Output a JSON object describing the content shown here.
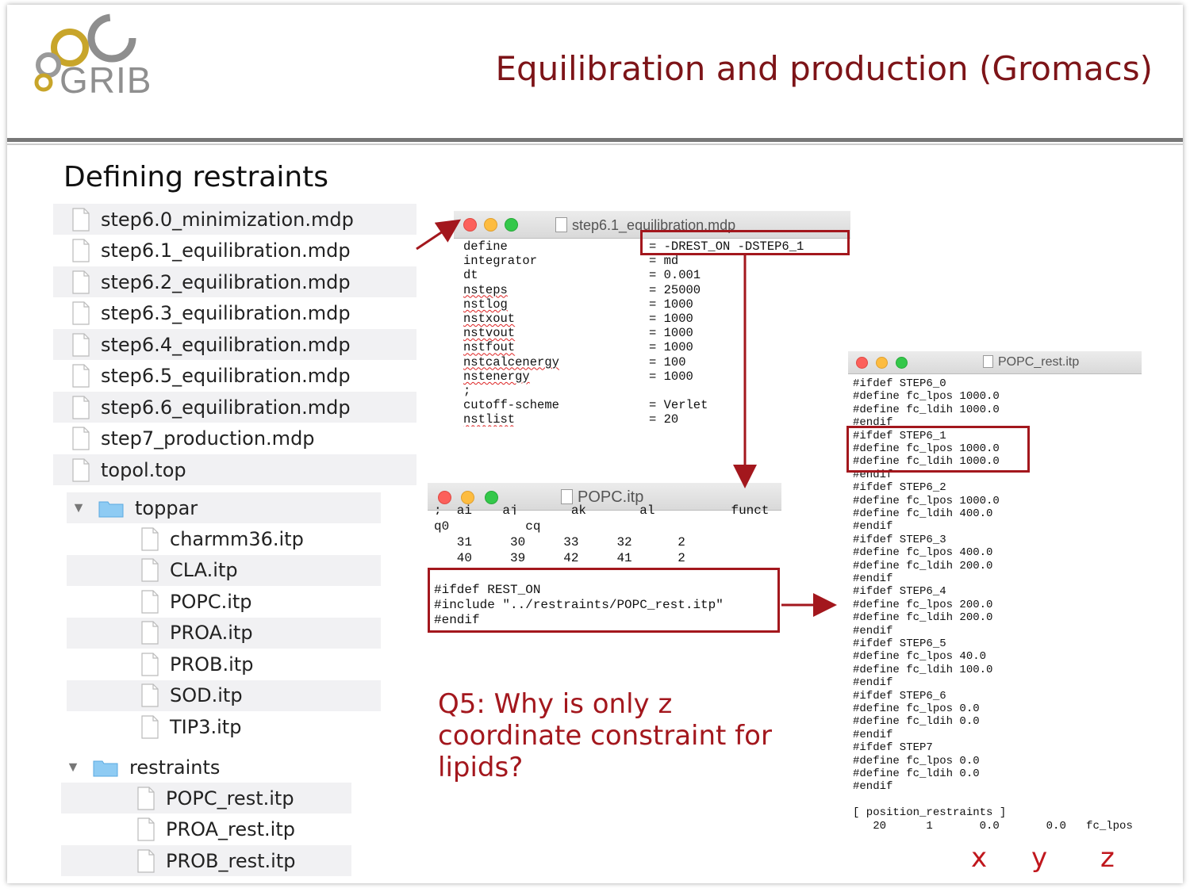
{
  "header": {
    "logo_text": "GRIB",
    "title": "Equilibration and production (Gromacs)"
  },
  "subtitle": "Defining restraints",
  "files": [
    "step6.0_minimization.mdp",
    "step6.1_equilibration.mdp",
    "step6.2_equilibration.mdp",
    "step6.3_equilibration.mdp",
    "step6.4_equilibration.mdp",
    "step6.5_equilibration.mdp",
    "step6.6_equilibration.mdp",
    "step7_production.mdp",
    "topol.top"
  ],
  "toppar": {
    "label": "toppar",
    "items": [
      "charmm36.itp",
      "CLA.itp",
      "POPC.itp",
      "PROA.itp",
      "PROB.itp",
      "SOD.itp",
      "TIP3.itp"
    ]
  },
  "restraints": {
    "label": "restraints",
    "items": [
      "POPC_rest.itp",
      "PROA_rest.itp",
      "PROB_rest.itp"
    ]
  },
  "mdp_window": {
    "title": "step6.1_equilibration.mdp",
    "lines": [
      [
        "define",
        "= -DREST_ON -DSTEP6_1"
      ],
      [
        "integrator",
        "= md"
      ],
      [
        "dt",
        "= 0.001"
      ],
      [
        "nsteps",
        "= 25000"
      ],
      [
        "nstlog",
        "= 1000"
      ],
      [
        "nstxout",
        "= 1000"
      ],
      [
        "nstvout",
        "= 1000"
      ],
      [
        "nstfout",
        "= 1000"
      ],
      [
        "nstcalcenergy",
        "= 100"
      ],
      [
        "nstenergy",
        "= 1000"
      ],
      [
        ";",
        ""
      ],
      [
        "cutoff-scheme",
        "= Verlet"
      ],
      [
        "nstlist",
        "= 20"
      ]
    ]
  },
  "popc_window": {
    "title": "POPC.itp",
    "cut_header": ";  ai    aj       ak       al          funct",
    "header2": "q0          cq",
    "rows": [
      "   31     30     33     32      2",
      "   40     39     42     41      2"
    ],
    "ifdef_block": [
      "#ifdef REST_ON",
      "#include \"../restraints/POPC_rest.itp\"",
      "#endif"
    ]
  },
  "rest_window": {
    "title": "POPC_rest.itp",
    "lines": [
      "#ifdef STEP6_0",
      "#define fc_lpos 1000.0",
      "#define fc_ldih 1000.0",
      "#endif",
      "#ifdef STEP6_1",
      "#define fc_lpos 1000.0",
      "#define fc_ldih 1000.0",
      "#endif",
      "#ifdef STEP6_2",
      "#define fc_lpos 1000.0",
      "#define fc_ldih 400.0",
      "#endif",
      "#ifdef STEP6_3",
      "#define fc_lpos 400.0",
      "#define fc_ldih 200.0",
      "#endif",
      "#ifdef STEP6_4",
      "#define fc_lpos 200.0",
      "#define fc_ldih 200.0",
      "#endif",
      "#ifdef STEP6_5",
      "#define fc_lpos 40.0",
      "#define fc_ldih 100.0",
      "#endif",
      "#ifdef STEP6_6",
      "#define fc_lpos 0.0",
      "#define fc_ldih 0.0",
      "#endif",
      "#ifdef STEP7",
      "#define fc_lpos 0.0",
      "#define fc_ldih 0.0",
      "#endif",
      "",
      "[ position_restraints ]",
      "   20      1       0.0       0.0   fc_lpos"
    ]
  },
  "question": "Q5: Why is only z coordinate constraint for lipids?",
  "axes": [
    "x",
    "y",
    "z"
  ],
  "colors": {
    "accent": "#a3171d",
    "title": "#7d1418"
  }
}
